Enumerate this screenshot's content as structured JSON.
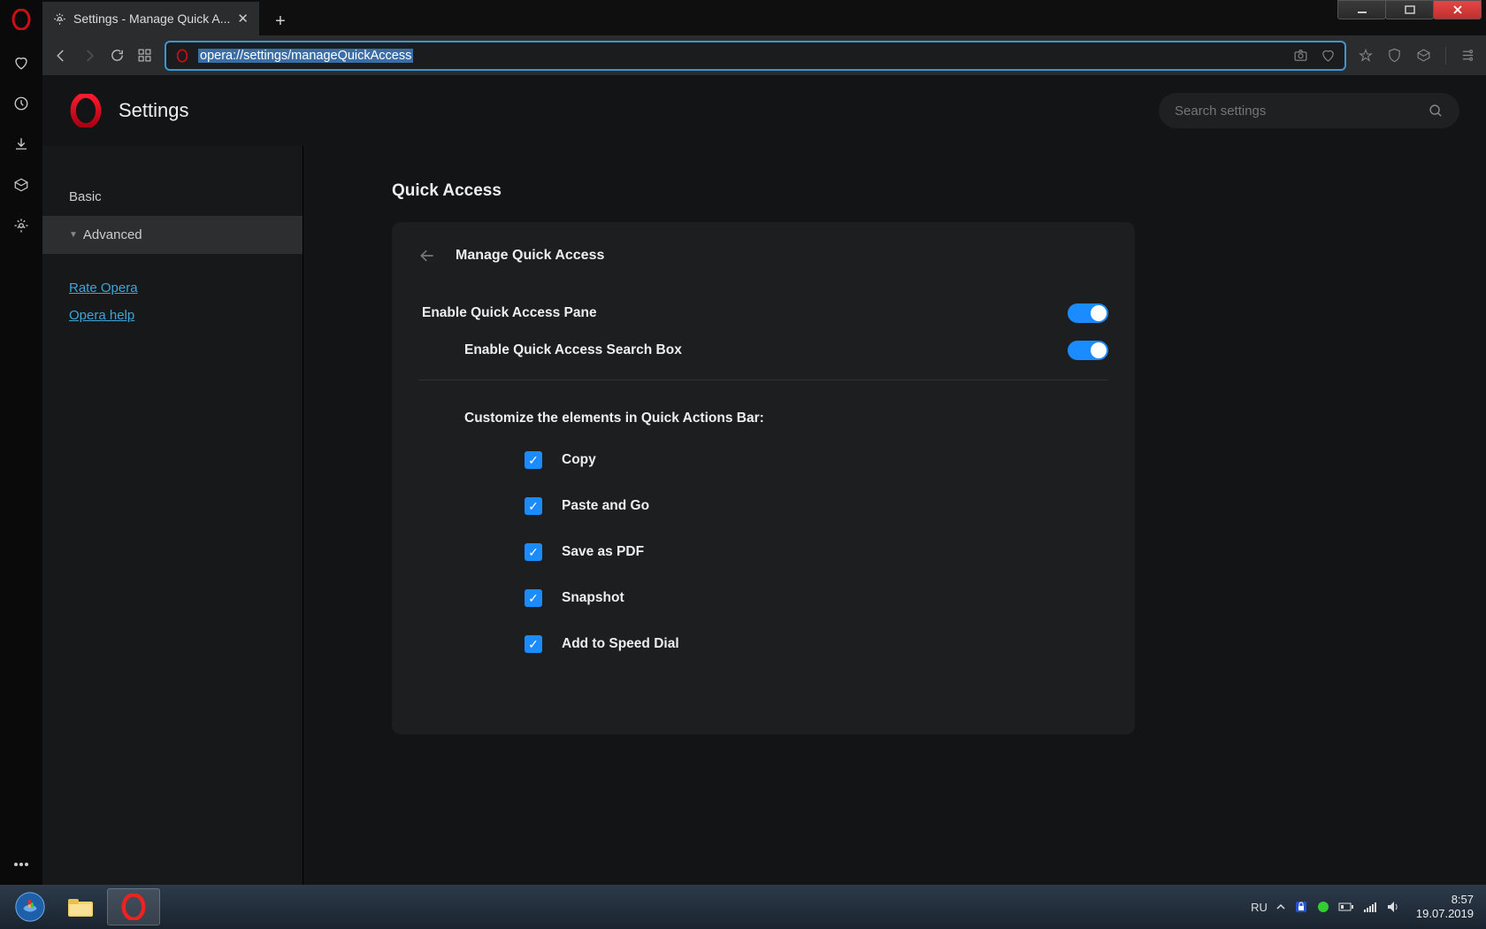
{
  "window": {
    "tab_title": "Settings - Manage Quick A..."
  },
  "address_bar": {
    "url": "opera://settings/manageQuickAccess"
  },
  "settings": {
    "title": "Settings",
    "search_placeholder": "Search settings",
    "sidebar": {
      "basic": "Basic",
      "advanced": "Advanced",
      "rate": "Rate Opera",
      "help": "Opera help"
    },
    "section_title": "Quick Access",
    "card": {
      "title": "Manage Quick Access",
      "enable_pane": "Enable Quick Access Pane",
      "enable_search": "Enable Quick Access Search Box",
      "customize_label": "Customize the elements in Quick Actions Bar:",
      "items": {
        "copy": "Copy",
        "paste_go": "Paste and Go",
        "save_pdf": "Save as PDF",
        "snapshot": "Snapshot",
        "speed_dial": "Add to Speed Dial"
      }
    }
  },
  "taskbar": {
    "lang": "RU",
    "time": "8:57",
    "date": "19.07.2019"
  }
}
